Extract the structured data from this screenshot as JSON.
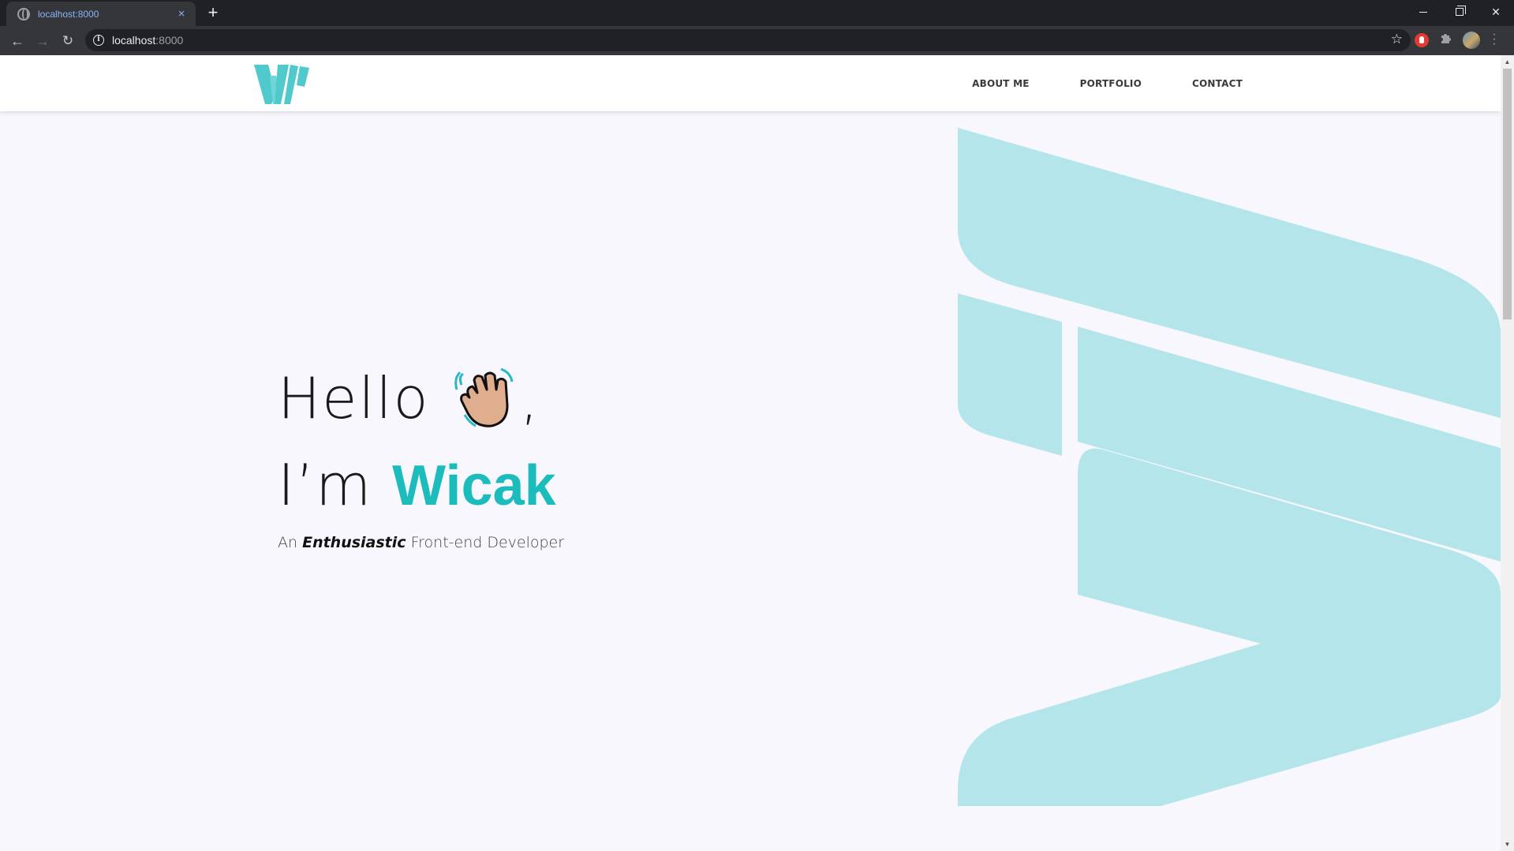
{
  "browser": {
    "tab_title": "localhost:8000",
    "tab_close": "×",
    "new_tab": "+",
    "url_host": "localhost",
    "url_port": ":8000",
    "nav_back": "←",
    "nav_forward": "→",
    "reload": "↻",
    "star": "☆",
    "window_close": "✕"
  },
  "site": {
    "nav": [
      "ABOUT ME",
      "PORTFOLIO",
      "CONTACT"
    ],
    "accent_color": "#1cbcbc",
    "shape_color": "#b3e5ea"
  },
  "hero": {
    "greeting": "Hello",
    "greeting_suffix": ",",
    "intro": "I’m",
    "name": "Wicak",
    "subtitle_prefix": "An",
    "subtitle_emphasis": "Enthusiastic",
    "subtitle_suffix": "Front-end Developer"
  }
}
